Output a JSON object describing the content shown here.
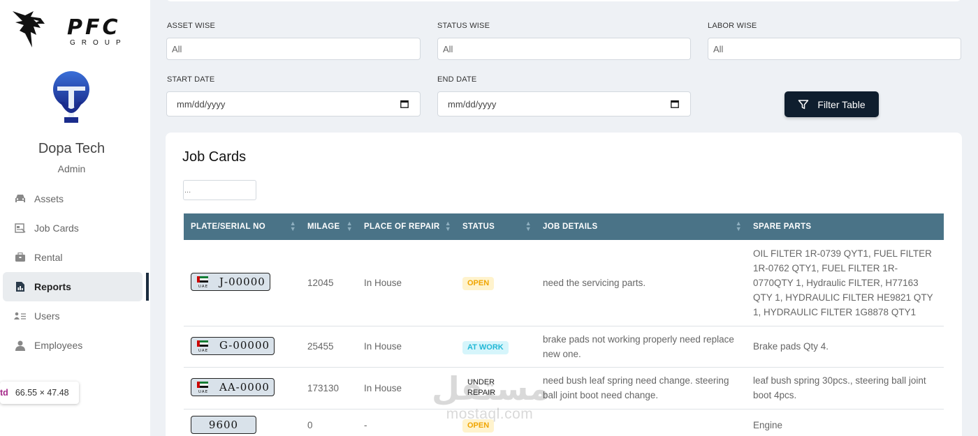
{
  "brand": {
    "name": "PFC",
    "sub": "GROUP"
  },
  "user": {
    "name": "Dopa Tech",
    "role": "Admin"
  },
  "nav": [
    {
      "label": "Assets",
      "icon": "car-icon"
    },
    {
      "label": "Job Cards",
      "icon": "id-card-icon"
    },
    {
      "label": "Rental",
      "icon": "briefcase-icon"
    },
    {
      "label": "Reports",
      "icon": "report-icon",
      "active": true
    },
    {
      "label": "Users",
      "icon": "users-icon"
    },
    {
      "label": "Employees",
      "icon": "person-icon"
    }
  ],
  "tooltip": {
    "tag": "td",
    "size": "66.55 × 47.48"
  },
  "filters": {
    "asset_label": "ASSET WISE",
    "asset_value": "All",
    "status_label": "STATUS WISE",
    "status_value": "All",
    "labor_label": "LABOR WISE",
    "labor_value": "All",
    "start_label": "START DATE",
    "start_value": "mm/dd/yyyy",
    "end_label": "END DATE",
    "end_value": "mm/dd/yyyy",
    "button_label": "Filter Table"
  },
  "card": {
    "title": "Job Cards",
    "search_placeholder": "..."
  },
  "table": {
    "columns": [
      "PLATE/SERIAL NO",
      "MILAGE",
      "PLACE OF REPAIR",
      "STATUS",
      "JOB DETAILS",
      "SPARE PARTS"
    ],
    "rows": [
      {
        "plate": "J-00000",
        "flag": true,
        "milage": "12045",
        "place": "In House",
        "status": "OPEN",
        "status_type": "open",
        "details": "need the servicing parts.",
        "parts": "OIL FILTER 1R-0739 QYT1, FUEL FILTER 1R-0762 QTY1, FUEL FILTER 1R-0770QTY 1, Hydraulic FILTER, H77163 QTY 1, HYDRAULIC FILTER HE9821 QTY 1, HYDRAULIC FILTER 1G8878 QTY1"
      },
      {
        "plate": "G-00000",
        "flag": true,
        "milage": "25455",
        "place": "In House",
        "status": "AT WORK",
        "status_type": "atwork",
        "details": "brake pads not working properly need replace new one.",
        "parts": "Brake pads Qty 4."
      },
      {
        "plate": "AA-0000",
        "flag": true,
        "milage": "173130",
        "place": "In House",
        "status": "UNDER REPAIR",
        "status_type": "repair",
        "details": "need bush leaf spring need change. steering ball joint boot need change.",
        "parts": "leaf bush spring 30pcs., steering ball joint boot 4pcs."
      },
      {
        "plate": "9600",
        "flag": false,
        "milage": "0",
        "place": "-",
        "status": "OPEN",
        "status_type": "open",
        "details": "",
        "parts": "Engine"
      }
    ]
  },
  "watermark": {
    "arabic": "مستقل",
    "latin": "mostaql.com"
  },
  "colors": {
    "header": "#4a7387",
    "button": "#0f1e2e",
    "sidebar_active_bar": "#1c2d3f"
  }
}
